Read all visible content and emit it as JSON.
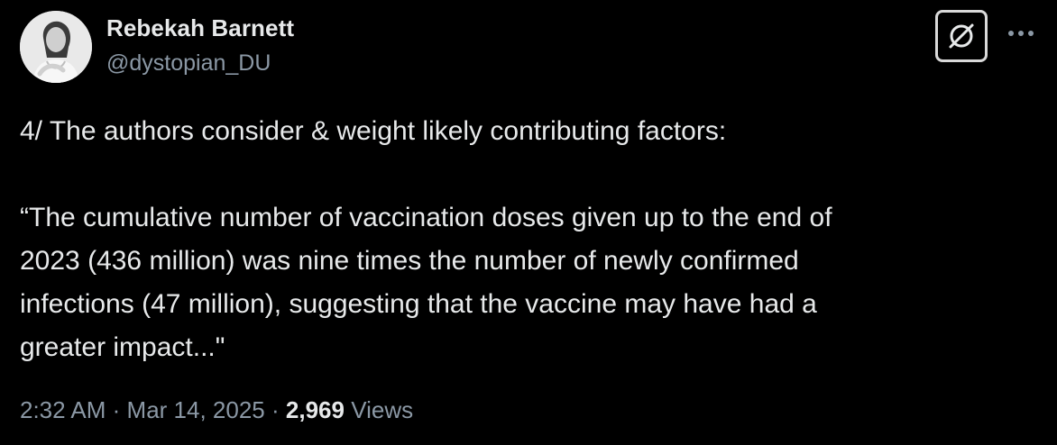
{
  "author": {
    "name": "Rebekah Barnett",
    "handle": "@dystopian_DU"
  },
  "icons": {
    "avatar": "profile-photo",
    "grok": "grok-icon",
    "more": "more-horizontal-icon"
  },
  "tweet": {
    "text": "4/ The authors consider & weight likely contributing factors:\n\n“The cumulative number of vaccination doses given up to the end of\n2023 (436 million) was nine times the number of newly confirmed\ninfections (47 million), suggesting that the vaccine may have had a\ngreater impact...\""
  },
  "meta": {
    "time": "2:32 AM",
    "separator": "·",
    "date": "Mar 14, 2025",
    "views_count": "2,969",
    "views_label": "Views"
  },
  "colors": {
    "background": "#000000",
    "primary_text": "#e7e9ea",
    "secondary_text": "#8b98a5"
  }
}
